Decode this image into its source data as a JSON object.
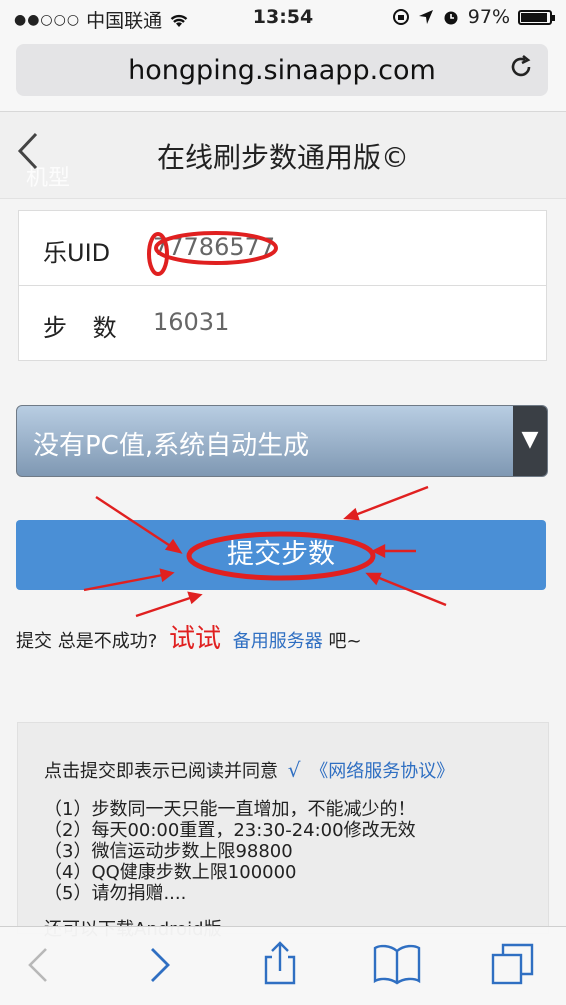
{
  "status_bar": {
    "signal": "●●○○○",
    "carrier": "中国联通",
    "wifi_icon": "wifi-icon",
    "time": "13:54",
    "battery_percent": "97%"
  },
  "browser": {
    "url": "hongping.sinaapp.com"
  },
  "page": {
    "title": "在线刷步数通用版©",
    "watermark": "机型"
  },
  "form": {
    "uid_label": "乐UID",
    "uid_value": "77786577",
    "steps_label": "步 数",
    "steps_value": "16031",
    "pc_select": "没有PC值,系统自动生成",
    "submit_label": "提交步数"
  },
  "hint": {
    "prefix": "提交 总是不成功?",
    "try": "试试",
    "backup": "备用服务器",
    "suffix": "吧~"
  },
  "info": {
    "agree_text": "点击提交即表示已阅读并同意",
    "check": "√",
    "agreement_link": "《网络服务协议》",
    "rules": [
      "（1）步数同一天只能一直增加，不能减少的！",
      "（2）每天00:00重置，23:30-24:00修改无效",
      "（3）微信运动步数上限98800",
      "（4）QQ健康步数上限100000",
      "（5）请勿捐赠...."
    ],
    "cut_text": "还可以下载Android版"
  },
  "colors": {
    "accent": "#4a8fd6",
    "link": "#2f6fc2",
    "annotation": "#e02020"
  }
}
